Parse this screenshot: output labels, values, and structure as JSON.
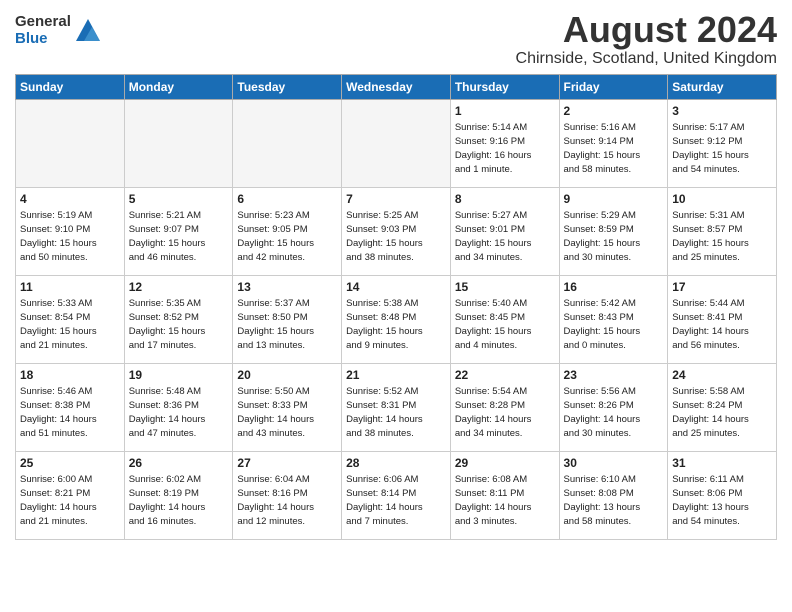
{
  "header": {
    "logo_general": "General",
    "logo_blue": "Blue",
    "title": "August 2024",
    "subtitle": "Chirnside, Scotland, United Kingdom"
  },
  "weekdays": [
    "Sunday",
    "Monday",
    "Tuesday",
    "Wednesday",
    "Thursday",
    "Friday",
    "Saturday"
  ],
  "weeks": [
    [
      {
        "day": "",
        "info": ""
      },
      {
        "day": "",
        "info": ""
      },
      {
        "day": "",
        "info": ""
      },
      {
        "day": "",
        "info": ""
      },
      {
        "day": "1",
        "info": "Sunrise: 5:14 AM\nSunset: 9:16 PM\nDaylight: 16 hours\nand 1 minute."
      },
      {
        "day": "2",
        "info": "Sunrise: 5:16 AM\nSunset: 9:14 PM\nDaylight: 15 hours\nand 58 minutes."
      },
      {
        "day": "3",
        "info": "Sunrise: 5:17 AM\nSunset: 9:12 PM\nDaylight: 15 hours\nand 54 minutes."
      }
    ],
    [
      {
        "day": "4",
        "info": "Sunrise: 5:19 AM\nSunset: 9:10 PM\nDaylight: 15 hours\nand 50 minutes."
      },
      {
        "day": "5",
        "info": "Sunrise: 5:21 AM\nSunset: 9:07 PM\nDaylight: 15 hours\nand 46 minutes."
      },
      {
        "day": "6",
        "info": "Sunrise: 5:23 AM\nSunset: 9:05 PM\nDaylight: 15 hours\nand 42 minutes."
      },
      {
        "day": "7",
        "info": "Sunrise: 5:25 AM\nSunset: 9:03 PM\nDaylight: 15 hours\nand 38 minutes."
      },
      {
        "day": "8",
        "info": "Sunrise: 5:27 AM\nSunset: 9:01 PM\nDaylight: 15 hours\nand 34 minutes."
      },
      {
        "day": "9",
        "info": "Sunrise: 5:29 AM\nSunset: 8:59 PM\nDaylight: 15 hours\nand 30 minutes."
      },
      {
        "day": "10",
        "info": "Sunrise: 5:31 AM\nSunset: 8:57 PM\nDaylight: 15 hours\nand 25 minutes."
      }
    ],
    [
      {
        "day": "11",
        "info": "Sunrise: 5:33 AM\nSunset: 8:54 PM\nDaylight: 15 hours\nand 21 minutes."
      },
      {
        "day": "12",
        "info": "Sunrise: 5:35 AM\nSunset: 8:52 PM\nDaylight: 15 hours\nand 17 minutes."
      },
      {
        "day": "13",
        "info": "Sunrise: 5:37 AM\nSunset: 8:50 PM\nDaylight: 15 hours\nand 13 minutes."
      },
      {
        "day": "14",
        "info": "Sunrise: 5:38 AM\nSunset: 8:48 PM\nDaylight: 15 hours\nand 9 minutes."
      },
      {
        "day": "15",
        "info": "Sunrise: 5:40 AM\nSunset: 8:45 PM\nDaylight: 15 hours\nand 4 minutes."
      },
      {
        "day": "16",
        "info": "Sunrise: 5:42 AM\nSunset: 8:43 PM\nDaylight: 15 hours\nand 0 minutes."
      },
      {
        "day": "17",
        "info": "Sunrise: 5:44 AM\nSunset: 8:41 PM\nDaylight: 14 hours\nand 56 minutes."
      }
    ],
    [
      {
        "day": "18",
        "info": "Sunrise: 5:46 AM\nSunset: 8:38 PM\nDaylight: 14 hours\nand 51 minutes."
      },
      {
        "day": "19",
        "info": "Sunrise: 5:48 AM\nSunset: 8:36 PM\nDaylight: 14 hours\nand 47 minutes."
      },
      {
        "day": "20",
        "info": "Sunrise: 5:50 AM\nSunset: 8:33 PM\nDaylight: 14 hours\nand 43 minutes."
      },
      {
        "day": "21",
        "info": "Sunrise: 5:52 AM\nSunset: 8:31 PM\nDaylight: 14 hours\nand 38 minutes."
      },
      {
        "day": "22",
        "info": "Sunrise: 5:54 AM\nSunset: 8:28 PM\nDaylight: 14 hours\nand 34 minutes."
      },
      {
        "day": "23",
        "info": "Sunrise: 5:56 AM\nSunset: 8:26 PM\nDaylight: 14 hours\nand 30 minutes."
      },
      {
        "day": "24",
        "info": "Sunrise: 5:58 AM\nSunset: 8:24 PM\nDaylight: 14 hours\nand 25 minutes."
      }
    ],
    [
      {
        "day": "25",
        "info": "Sunrise: 6:00 AM\nSunset: 8:21 PM\nDaylight: 14 hours\nand 21 minutes."
      },
      {
        "day": "26",
        "info": "Sunrise: 6:02 AM\nSunset: 8:19 PM\nDaylight: 14 hours\nand 16 minutes."
      },
      {
        "day": "27",
        "info": "Sunrise: 6:04 AM\nSunset: 8:16 PM\nDaylight: 14 hours\nand 12 minutes."
      },
      {
        "day": "28",
        "info": "Sunrise: 6:06 AM\nSunset: 8:14 PM\nDaylight: 14 hours\nand 7 minutes."
      },
      {
        "day": "29",
        "info": "Sunrise: 6:08 AM\nSunset: 8:11 PM\nDaylight: 14 hours\nand 3 minutes."
      },
      {
        "day": "30",
        "info": "Sunrise: 6:10 AM\nSunset: 8:08 PM\nDaylight: 13 hours\nand 58 minutes."
      },
      {
        "day": "31",
        "info": "Sunrise: 6:11 AM\nSunset: 8:06 PM\nDaylight: 13 hours\nand 54 minutes."
      }
    ]
  ]
}
